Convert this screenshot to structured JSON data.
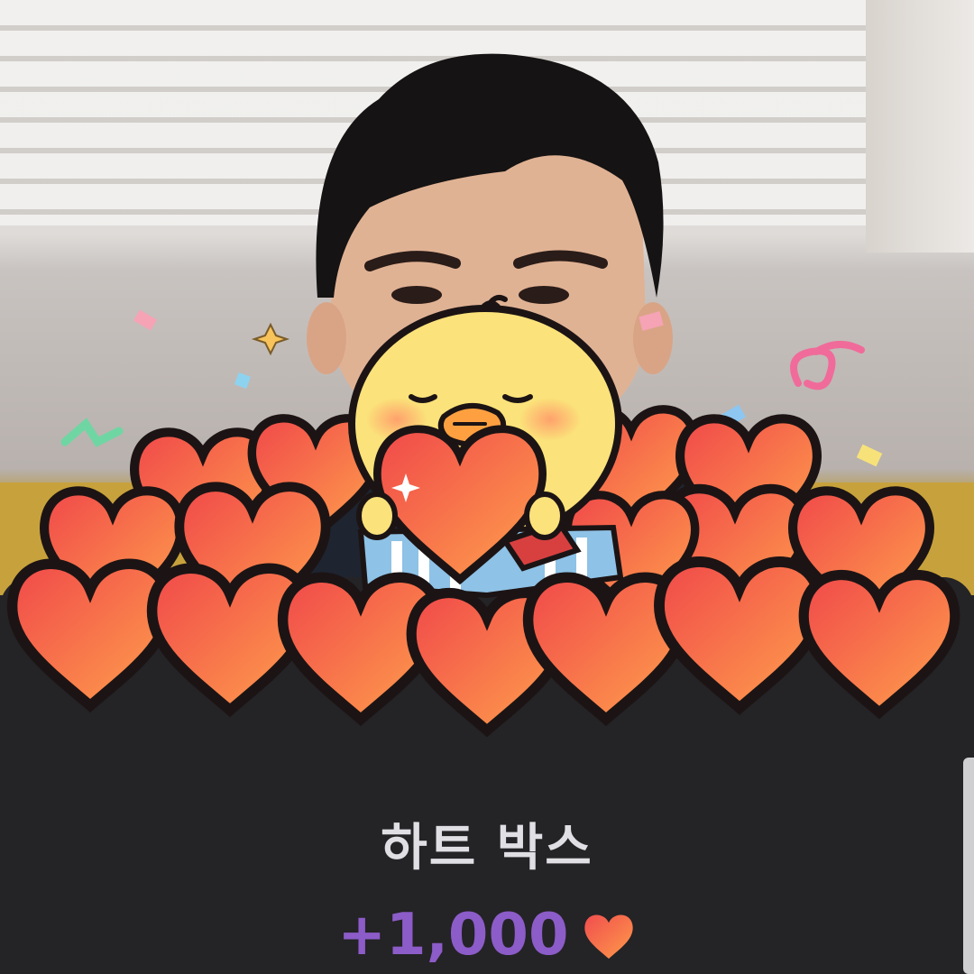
{
  "gift": {
    "title": "하트 박스",
    "amount": "+1,000",
    "currency_icon": "heart-icon"
  },
  "colors": {
    "sheet_background": "#242326",
    "title_text": "#e0dfe3",
    "amount_text": "#8c5cc8",
    "heart_fill_top": "#f04e4e",
    "heart_fill_bottom": "#ff9a4a"
  }
}
